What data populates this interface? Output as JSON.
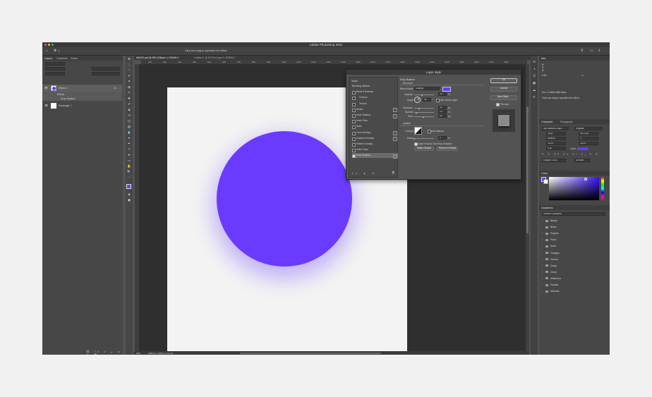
{
  "app": {
    "title": "Adobe Photoshop 2021"
  },
  "options_bar": {
    "hint": "Click and drag to reposition the effect."
  },
  "doc_tabs": [
    {
      "label": "IMAGE.psd @ 99% (Ellipse 1, RGB/8*) *",
      "active": true
    },
    {
      "label": "Untitled-1 @ 63.3% (Layer 0, RGB/8*) *",
      "active": false
    }
  ],
  "layers_panel": {
    "tabs": [
      "Layers",
      "Channels",
      "Paths"
    ],
    "layers": [
      {
        "name": "Ellipse 1",
        "fx": "fx"
      },
      {
        "name": "Effects"
      },
      {
        "name": "Drop Shadow"
      },
      {
        "name": "Rectangle 1"
      }
    ]
  },
  "ruler": {
    "ticks": [
      "100",
      "200",
      "300",
      "400",
      "500",
      "600",
      "700",
      "800",
      "900",
      "1000",
      "1100",
      "1200",
      "1300",
      "1400",
      "1500",
      "1600",
      "1700",
      "1800",
      "1900",
      "2000",
      "2100",
      "2200",
      "2300",
      "2400",
      "2500"
    ]
  },
  "canvas": {
    "ellipse_color": "#6a3bff",
    "page_color": "#f3f3f3",
    "workspace_color": "#2f2f2f"
  },
  "status_bar": {
    "zoom": "99%",
    "doc_info": "1080 px x 1080 px (72 ppi)"
  },
  "layer_style": {
    "title": "Layer Style",
    "styles_header": "Styles",
    "items": [
      {
        "label": "Blending Options",
        "checkbox": false,
        "plus": false
      },
      {
        "label": "Bevel & Emboss",
        "checkbox": true,
        "plus": false
      },
      {
        "label": "Contour",
        "checkbox": true,
        "plus": false,
        "indent": true
      },
      {
        "label": "Texture",
        "checkbox": true,
        "plus": false,
        "indent": true
      },
      {
        "label": "Stroke",
        "checkbox": true,
        "plus": true
      },
      {
        "label": "Inner Shadow",
        "checkbox": true,
        "plus": true
      },
      {
        "label": "Inner Glow",
        "checkbox": true,
        "plus": false
      },
      {
        "label": "Satin",
        "checkbox": true,
        "plus": false
      },
      {
        "label": "Color Overlay",
        "checkbox": true,
        "plus": true
      },
      {
        "label": "Gradient Overlay",
        "checkbox": true,
        "plus": true
      },
      {
        "label": "Pattern Overlay",
        "checkbox": true,
        "plus": false
      },
      {
        "label": "Outer Glow",
        "checkbox": true,
        "plus": false
      },
      {
        "label": "Drop Shadow",
        "checkbox": true,
        "checked": true,
        "plus": true,
        "selected": true
      }
    ],
    "footer_icons": [
      "fx",
      "▲",
      "▼",
      "🗑"
    ],
    "section_title": "Drop Shadow",
    "structure_label": "Structure",
    "blend_mode_label": "Blend Mode:",
    "blend_mode_value": "Multiply",
    "shadow_color": "#6a3bff",
    "opacity_label": "Opacity:",
    "opacity_value": "35",
    "opacity_unit": "%",
    "angle_label": "Angle:",
    "angle_value": "90",
    "angle_unit": "°",
    "global_light_label": "Use Global Light",
    "distance_label": "Distance:",
    "distance_value": "40",
    "distance_unit": "px",
    "spread_label": "Spread:",
    "spread_value": "10",
    "spread_unit": "%",
    "size_label": "Size:",
    "size_value": "80",
    "size_unit": "px",
    "quality_label": "Quality",
    "contour_label": "Contour:",
    "anti_aliased_label": "Anti-aliased",
    "noise_label": "Noise:",
    "noise_value": "0",
    "noise_unit": "%",
    "knockout_label": "Layer Knocks Out Drop Shadow",
    "make_default": "Make Default",
    "reset_default": "Reset to Default",
    "ok": "OK",
    "cancel": "Cancel",
    "new_style": "New Style...",
    "preview": "Preview"
  },
  "info_panel": {
    "tab": "Info",
    "rgb_values": [
      "",
      "",
      ""
    ],
    "pct_values": [
      "",
      ""
    ],
    "coord": "",
    "doc_line": "Doc: 3.34M/6.58M bytes",
    "hint": "Click and drag to reposition the effect."
  },
  "character_panel": {
    "tabs": [
      "Character",
      "Paragraph"
    ],
    "font": "Nib Medium Displ...",
    "style": "Regular",
    "size": "36 pt",
    "leading": "48.75 pt",
    "tracking_mode": "Metrics",
    "tracking": "0",
    "vscale": "100%",
    "hscale": "100%",
    "baseline": "0 pt",
    "color_label": "Color:",
    "language": "English: USA",
    "aa": "Smooth"
  },
  "color_panel": {
    "tab": "Color"
  },
  "gradients_panel": {
    "tab": "Gradients",
    "search_placeholder": "Search Gradients",
    "groups": [
      "Basics",
      "Blues",
      "Purples",
      "Pinks",
      "Reds",
      "Oranges",
      "Greens",
      "Grays",
      "Cloud",
      "Iridescent",
      "Pastels",
      "Neutrals"
    ]
  }
}
